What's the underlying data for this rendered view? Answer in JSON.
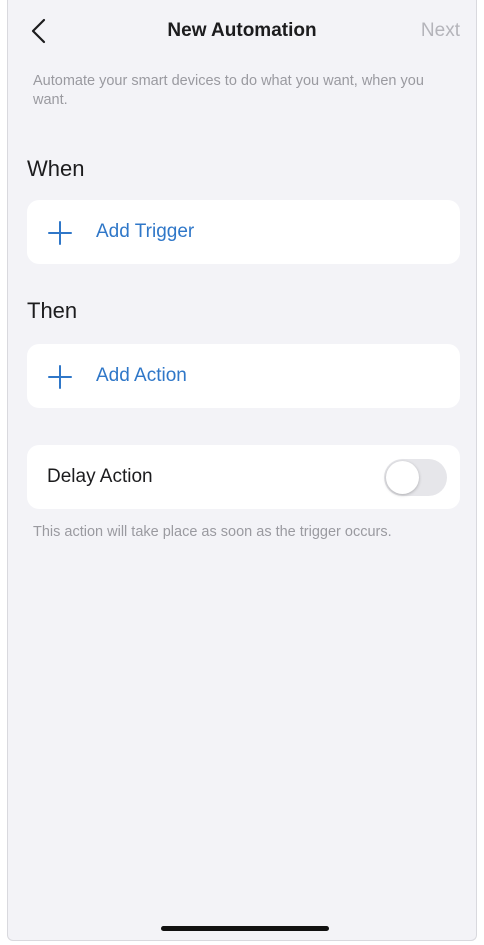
{
  "nav": {
    "back_icon": "chevron-left-icon",
    "title": "New Automation",
    "next_label": "Next"
  },
  "description": "Automate your smart devices to do what you want, when you want.",
  "when": {
    "heading": "When",
    "add_label": "Add Trigger",
    "add_icon": "plus-icon"
  },
  "then": {
    "heading": "Then",
    "add_label": "Add Action",
    "add_icon": "plus-icon"
  },
  "delay": {
    "label": "Delay Action",
    "enabled": false,
    "note": "This action will take place as soon as the trigger occurs."
  },
  "colors": {
    "accent": "#2f77c8",
    "background": "#f3f3f7",
    "card": "#ffffff",
    "muted_text": "#9a9aa0",
    "disabled_text": "#b4b4ba"
  }
}
